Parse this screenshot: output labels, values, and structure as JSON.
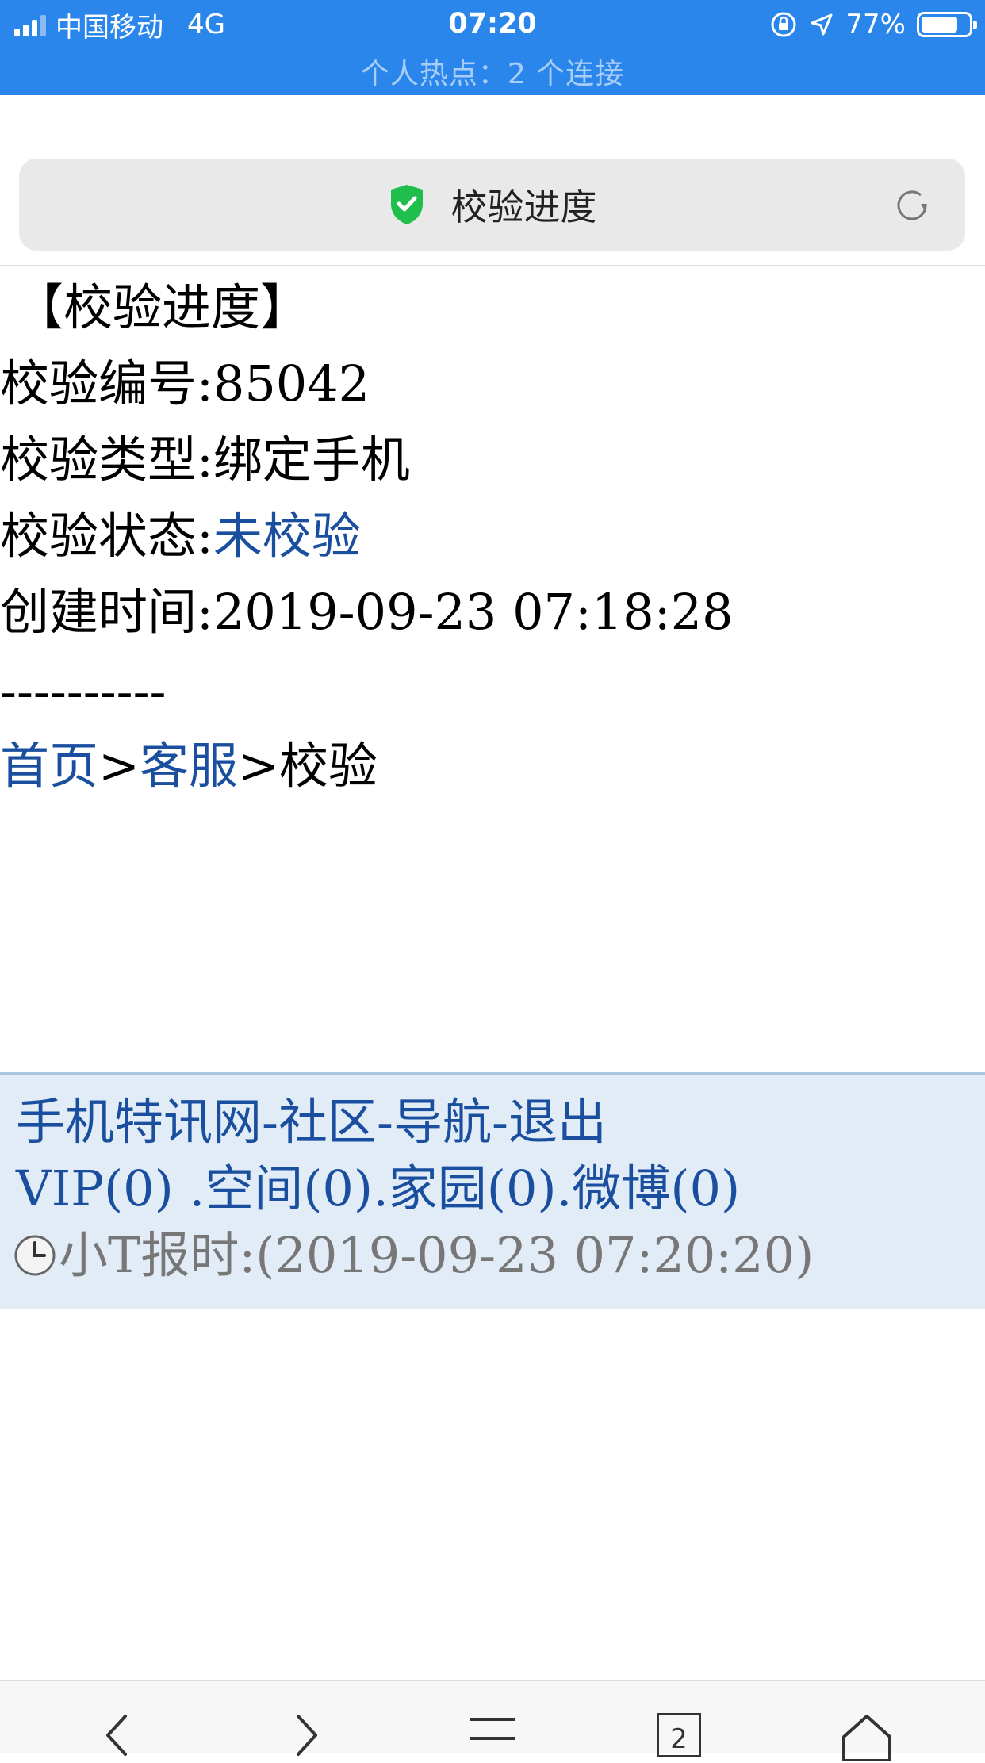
{
  "status_bar": {
    "carrier": "中国移动",
    "network": "4G",
    "time": "07:20",
    "battery_text": "77%",
    "battery_level": 0.77,
    "hotspot_text": "个人热点：2 个连接",
    "colors": {
      "background": "#2a86ea"
    }
  },
  "address_bar": {
    "title": "校验进度",
    "icons": [
      "shield-check-icon",
      "reload-icon"
    ]
  },
  "page": {
    "heading": "【校验进度】",
    "fields": {
      "number_label": "校验编号:",
      "number_value": "85042",
      "type_label": "校验类型:",
      "type_value": "绑定手机",
      "status_label": "校验状态:",
      "status_value": "未校验",
      "created_label": "创建时间:",
      "created_value": "2019-09-23 07:18:28"
    },
    "divider": "----------",
    "breadcrumb": {
      "home": "首页",
      "sep1": ">",
      "service": "客服",
      "sep2": ">",
      "current": "校验"
    }
  },
  "footer": {
    "nav": {
      "site": "手机特讯网",
      "sep1": "-",
      "community": "社区",
      "sep2": "-",
      "navigation": "导航",
      "sep3": "-",
      "logout": "退出"
    },
    "counts": {
      "vip": "VIP(0)",
      "sep1": " .",
      "space": "空间(0)",
      "sep2": ".",
      "home": "家园(0)",
      "sep3": ".",
      "weibo": "微博(0)"
    },
    "time_label": "小T报时:",
    "time_value": "(2019-09-23 07:20:20)"
  },
  "toolbar": {
    "tab_count": "2",
    "icons": [
      "back-icon",
      "forward-icon",
      "menu-icon",
      "tabs-icon",
      "home-icon"
    ]
  }
}
